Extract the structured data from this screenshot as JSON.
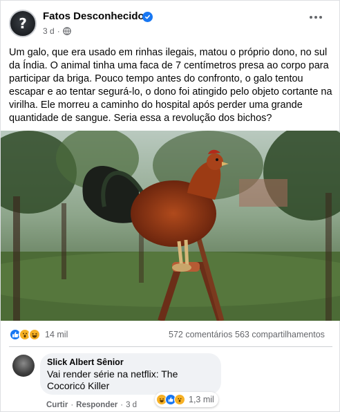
{
  "post": {
    "page_name": "Fatos Desconhecidos",
    "time": "3 d",
    "dot": "·",
    "text": "Um galo, que era usado em rinhas ilegais, matou o próprio dono, no sul da Índia. O animal tinha uma faca de 7 centímetros presa ao corpo para participar da briga. Pouco tempo antes do confronto, o galo tentou escapar e ao tentar segurá-lo, o dono foi atingido pelo objeto cortante na virilha. Ele morreu a caminho do hospital após perder uma grande quantidade de sangue. Seria essa a revolução dos bichos?"
  },
  "stats": {
    "reactions_count": "14 mil",
    "comments": "572 comentários",
    "shares": "563 compartilhamentos",
    "reaction_icons": [
      "like-icon",
      "wow-icon",
      "haha-icon"
    ]
  },
  "comment": {
    "author": "Slick Albert Sênior",
    "text": "Vai render série na netflix: The Cocoricó Killer",
    "reactions_count": "1,3 mil",
    "reaction_icons": [
      "haha-icon",
      "like-icon",
      "wow-icon"
    ],
    "like_label": "Curtir",
    "reply_label": "Responder",
    "sep": "·",
    "time": "3 d"
  },
  "colors": {
    "accent": "#1877f2",
    "secondary_text": "#65676b",
    "emoji_yellow": "#f7b125"
  }
}
